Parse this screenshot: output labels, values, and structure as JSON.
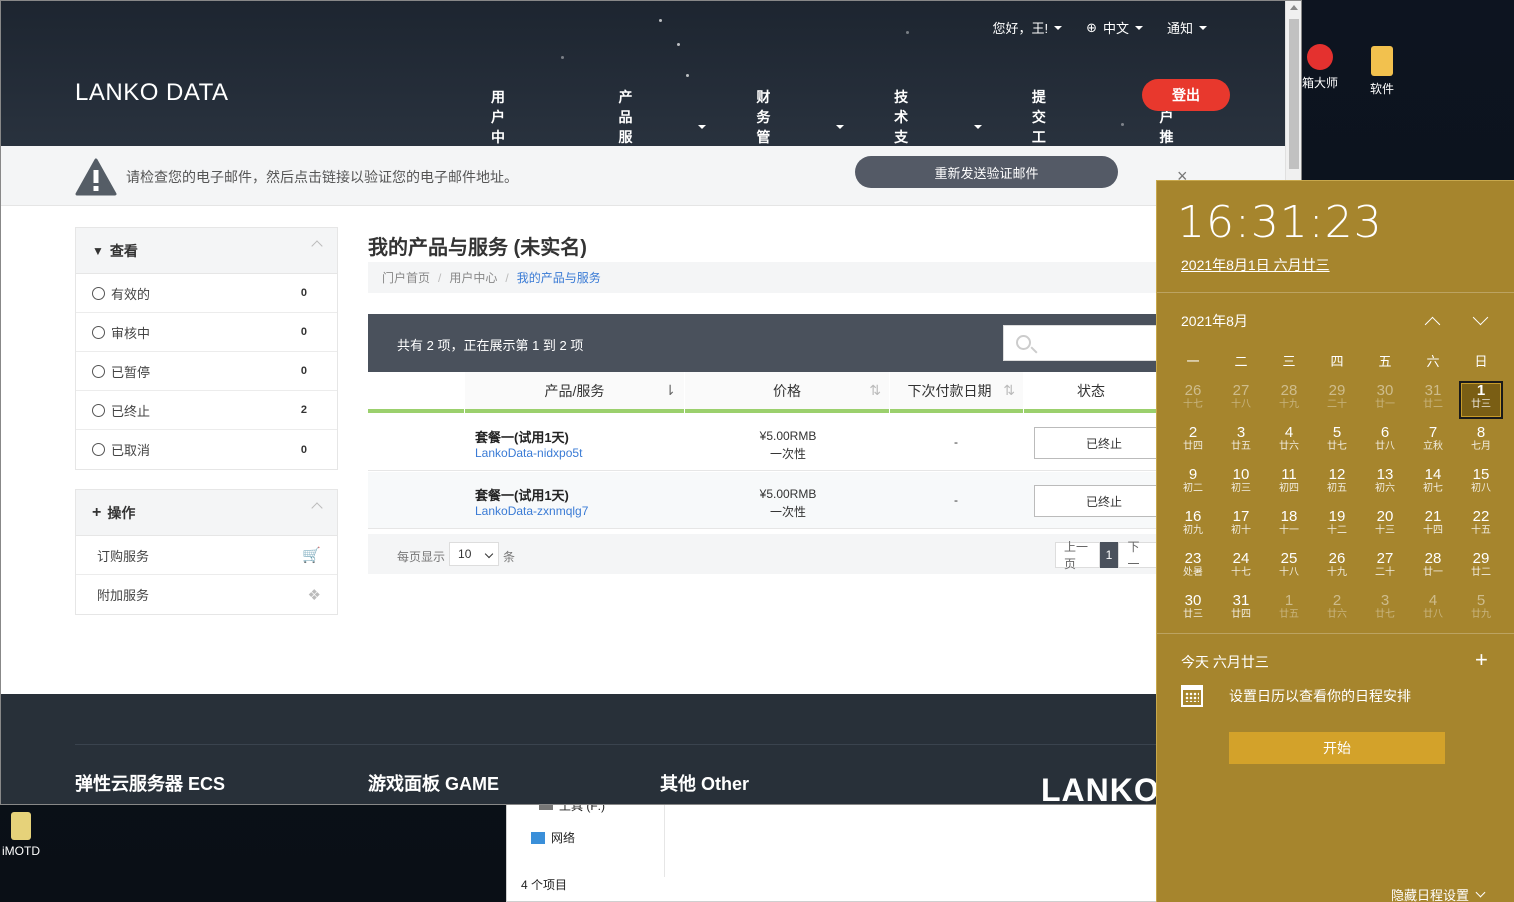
{
  "desktop": {
    "icons": [
      {
        "label": "箱大师",
        "name": "toolbox-master"
      },
      {
        "label": "软件",
        "name": "software"
      },
      {
        "label": "iMOTD",
        "name": "imotd"
      }
    ]
  },
  "explorer": {
    "drive_label": "工具 (F:)",
    "network_label": "网络",
    "status": "4 个项目"
  },
  "site": {
    "greeting": "您好，王!",
    "language": "中文",
    "notify": "通知",
    "logo": "LANKO DATA",
    "nav": [
      "用户中心",
      "产品服务",
      "财务管理",
      "技术支持",
      "提交工单",
      "用户推广"
    ],
    "logout": "登出",
    "alert_text": "请检查您的电子邮件，然后点击链接以验证您的电子邮件地址。",
    "resend": "重新发送验证邮件",
    "close": "×"
  },
  "sidebar": {
    "view_title": "查看",
    "filters": [
      {
        "label": "有效的",
        "count": "0"
      },
      {
        "label": "审核中",
        "count": "0"
      },
      {
        "label": "已暂停",
        "count": "0"
      },
      {
        "label": "已终止",
        "count": "2"
      },
      {
        "label": "已取消",
        "count": "0"
      }
    ],
    "actions_title": "操作",
    "actions": [
      {
        "label": "订购服务"
      },
      {
        "label": "附加服务"
      }
    ]
  },
  "main": {
    "title": "我的产品与服务 (未实名)",
    "breadcrumb": [
      "门户首页",
      "用户中心",
      "我的产品与服务"
    ],
    "table_info": "共有 2 项，正在展示第 1 到 2 项",
    "columns": [
      "产品/服务",
      "价格",
      "下次付款日期",
      "状态"
    ],
    "rows": [
      {
        "name": "套餐一(试用1天)",
        "host": "LankoData-nidxpo5t",
        "price": "¥5.00RMB",
        "cycle": "一次性",
        "due": "-",
        "status": "已终止"
      },
      {
        "name": "套餐一(试用1天)",
        "host": "LankoData-zxnmqlg7",
        "price": "¥5.00RMB",
        "cycle": "一次性",
        "due": "-",
        "status": "已终止"
      }
    ],
    "per_page_label": "每页显示",
    "per_page_value": "10",
    "per_page_unit": "条",
    "pager": {
      "prev": "上一页",
      "current": "1",
      "next": "下一"
    }
  },
  "footer": {
    "headings": [
      "弹性云服务器 ECS",
      "游戏面板 GAME",
      "其他 Other"
    ],
    "logo": "LANKO DATA"
  },
  "calendar": {
    "time": "16:31:23",
    "date_line": "2021年8月1日 六月廿三",
    "month": "2021年8月",
    "weekdays": [
      "一",
      "二",
      "三",
      "四",
      "五",
      "六",
      "日"
    ],
    "days": [
      {
        "d": "26",
        "l": "十七",
        "muted": true
      },
      {
        "d": "27",
        "l": "十八",
        "muted": true
      },
      {
        "d": "28",
        "l": "十九",
        "muted": true
      },
      {
        "d": "29",
        "l": "二十",
        "muted": true
      },
      {
        "d": "30",
        "l": "廿一",
        "muted": true
      },
      {
        "d": "31",
        "l": "廿二",
        "muted": true
      },
      {
        "d": "1",
        "l": "廿三",
        "today": true
      },
      {
        "d": "2",
        "l": "廿四"
      },
      {
        "d": "3",
        "l": "廿五"
      },
      {
        "d": "4",
        "l": "廿六"
      },
      {
        "d": "5",
        "l": "廿七"
      },
      {
        "d": "6",
        "l": "廿八"
      },
      {
        "d": "7",
        "l": "立秋"
      },
      {
        "d": "8",
        "l": "七月"
      },
      {
        "d": "9",
        "l": "初二"
      },
      {
        "d": "10",
        "l": "初三"
      },
      {
        "d": "11",
        "l": "初四"
      },
      {
        "d": "12",
        "l": "初五"
      },
      {
        "d": "13",
        "l": "初六"
      },
      {
        "d": "14",
        "l": "初七"
      },
      {
        "d": "15",
        "l": "初八"
      },
      {
        "d": "16",
        "l": "初九"
      },
      {
        "d": "17",
        "l": "初十"
      },
      {
        "d": "18",
        "l": "十一"
      },
      {
        "d": "19",
        "l": "十二"
      },
      {
        "d": "20",
        "l": "十三"
      },
      {
        "d": "21",
        "l": "十四"
      },
      {
        "d": "22",
        "l": "十五"
      },
      {
        "d": "23",
        "l": "处暑"
      },
      {
        "d": "24",
        "l": "十七"
      },
      {
        "d": "25",
        "l": "十八"
      },
      {
        "d": "26",
        "l": "十九"
      },
      {
        "d": "27",
        "l": "二十"
      },
      {
        "d": "28",
        "l": "廿一"
      },
      {
        "d": "29",
        "l": "廿二"
      },
      {
        "d": "30",
        "l": "廿三"
      },
      {
        "d": "31",
        "l": "廿四"
      },
      {
        "d": "1",
        "l": "廿五",
        "muted": true
      },
      {
        "d": "2",
        "l": "廿六",
        "muted": true
      },
      {
        "d": "3",
        "l": "廿七",
        "muted": true
      },
      {
        "d": "4",
        "l": "廿八",
        "muted": true
      },
      {
        "d": "5",
        "l": "廿九",
        "muted": true
      }
    ],
    "today_line": "今天 六月廿三",
    "agenda_text": "设置日历以查看你的日程安排",
    "start": "开始",
    "hide": "隐藏日程设置"
  }
}
